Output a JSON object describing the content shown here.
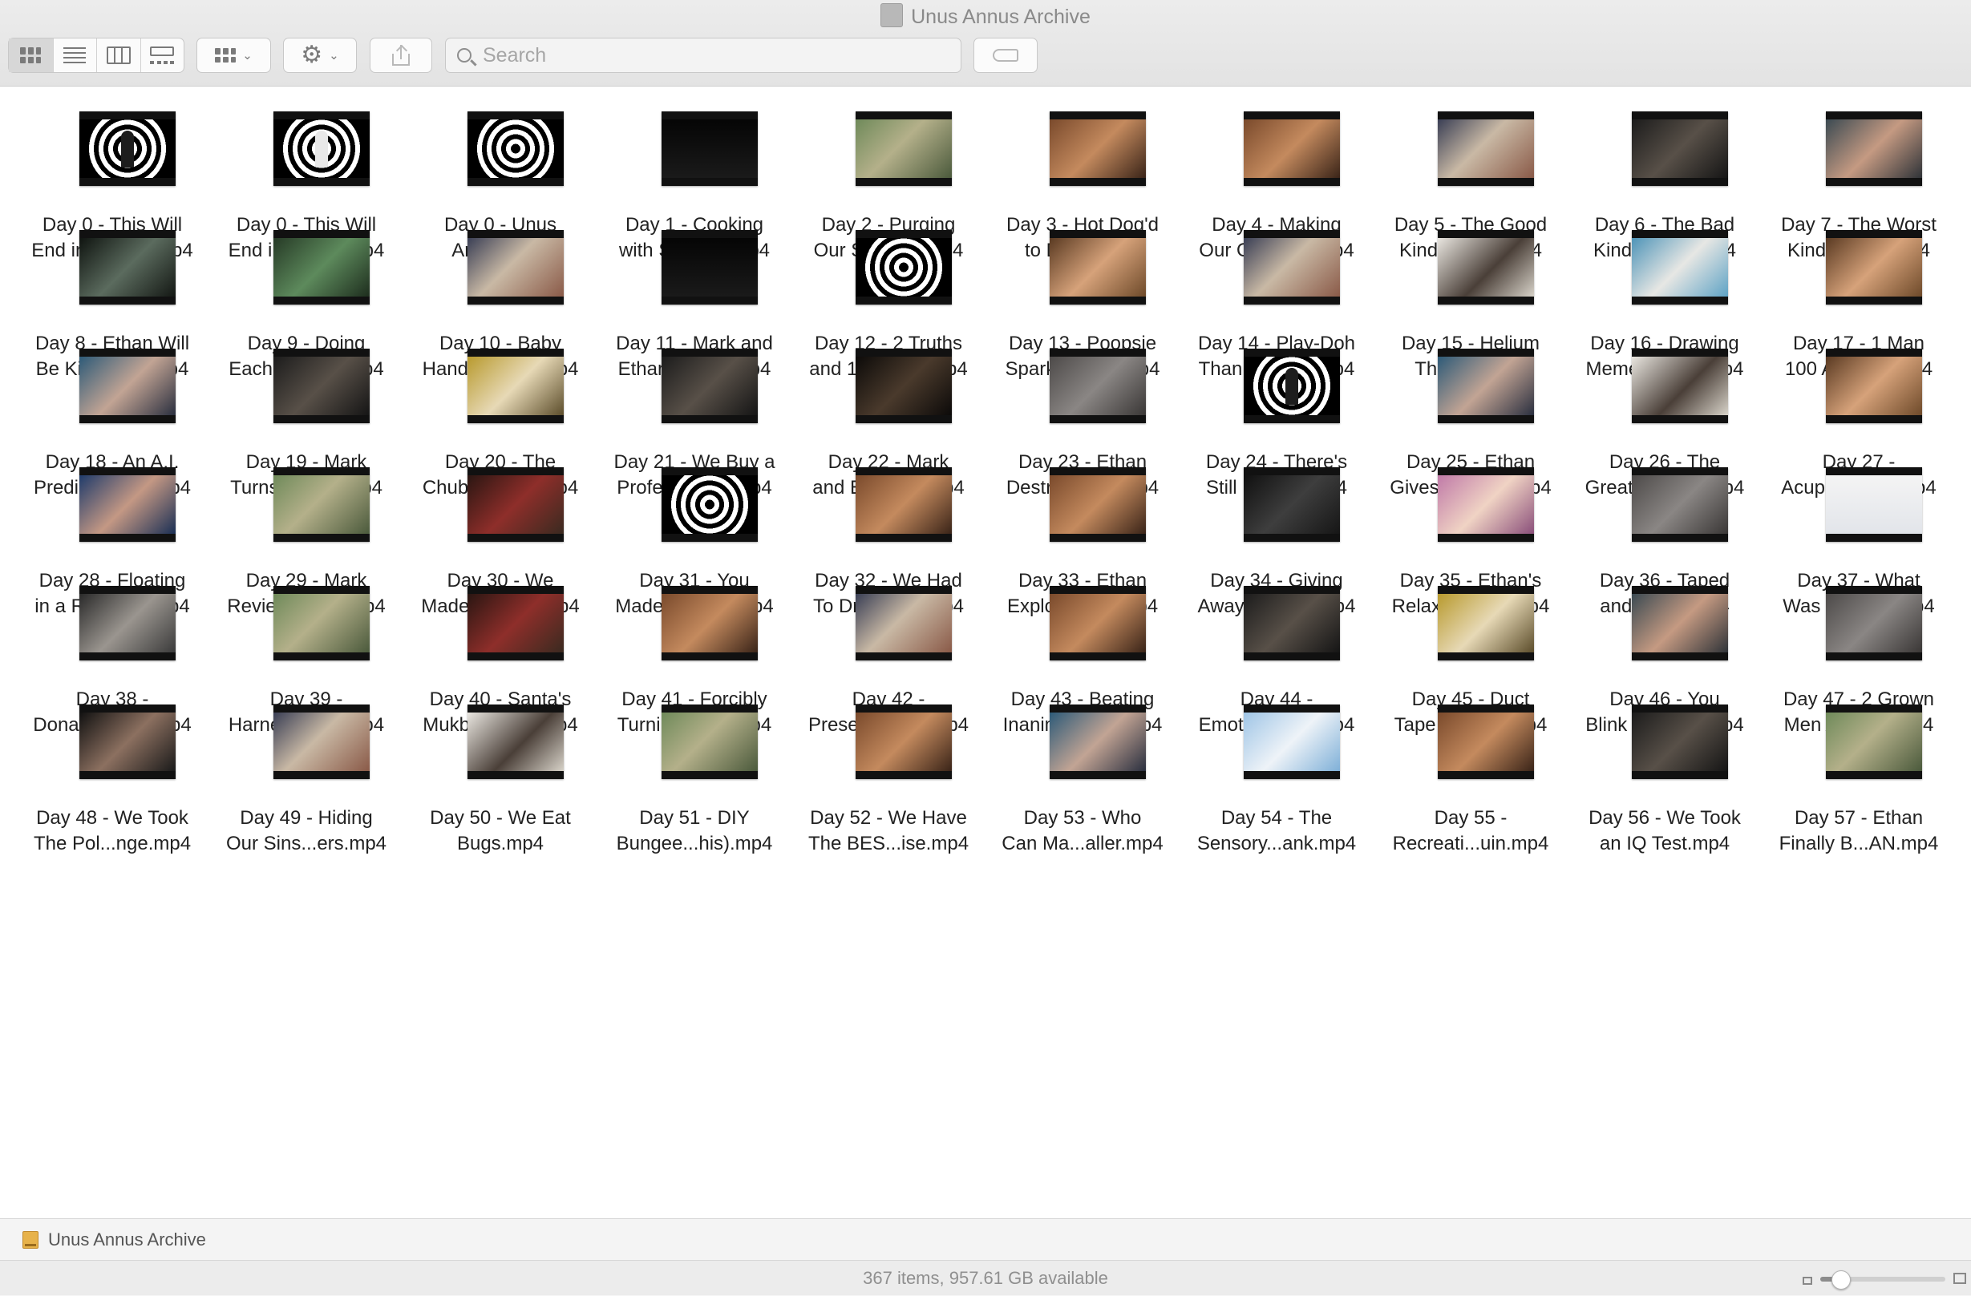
{
  "window": {
    "title": "Unus Annus Archive"
  },
  "toolbar": {
    "view_modes": [
      "icon-view",
      "list-view",
      "column-view",
      "gallery-view"
    ],
    "active_view": "icon-view",
    "group_icon": "group-by-icon",
    "action_icon": "gear-icon",
    "share_icon": "share-icon",
    "tag_icon": "tag-icon"
  },
  "search": {
    "placeholder": "Search",
    "value": ""
  },
  "files": [
    {
      "line1": "Day 0 - This Will",
      "line2": "End in O...an).mp4",
      "thumb": "spiral-person"
    },
    {
      "line1": "Day 0 - This Will",
      "line2": "End in O...rk).mp4",
      "thumb": "spiral-person-light"
    },
    {
      "line1": "Day 0 - Unus",
      "line2": "Annus.mp4",
      "thumb": "spiral"
    },
    {
      "line1": "Day 1 - Cooking",
      "line2": "with Sex...ys.mp4",
      "thumb": "text-card"
    },
    {
      "line1": "Day 2 - Purging",
      "line2": "Our Sins...ot.mp4",
      "thumb": "outdoor"
    },
    {
      "line1": "Day 3 - Hot Dog'd",
      "line2": "to Death.mp4",
      "thumb": "warm"
    },
    {
      "line1": "Day 4 - Making",
      "line2": "Our Ow...ank.mp4",
      "thumb": "warm"
    },
    {
      "line1": "Day 5 - The Good",
      "line2": "Kind of...🙂.mp4",
      "thumb": "studio"
    },
    {
      "line1": "Day 6 - The Bad",
      "line2": "Kind of...😐.mp4",
      "thumb": "dark-two"
    },
    {
      "line1": "Day 7 - The Worst",
      "line2": "Kind of...😨.mp4",
      "thumb": "face"
    },
    {
      "line1": "Day 8 - Ethan Will",
      "line2": "Be Kick...alls.mp4",
      "thumb": "night"
    },
    {
      "line1": "Day 9 - Doing",
      "line2": "Each Ot...ark.mp4",
      "thumb": "green"
    },
    {
      "line1": "Day 10 - Baby",
      "line2": "Hands...ation.mp4",
      "thumb": "studio"
    },
    {
      "line1": "Day 11 - Mark and",
      "line2": "Ethan S...ost.mp4",
      "thumb": "text-card"
    },
    {
      "line1": "Day 12 - 2 Truths",
      "line2": "and 1 Li...tion.mp4",
      "thumb": "spiral"
    },
    {
      "line1": "Day 13 - Poopsie",
      "line2": "Sparkly...e...).mp4",
      "thumb": "face-warm"
    },
    {
      "line1": "Day 14 - Play-Doh",
      "line2": "Thanksgiving.mp4",
      "thumb": "studio"
    },
    {
      "line1": "Day 15 - Helium",
      "line2": "Therapy.mp4",
      "thumb": "bright"
    },
    {
      "line1": "Day 16 - Drawing",
      "line2": "Memes f...ory.mp4",
      "thumb": "pool"
    },
    {
      "line1": "Day 17 - 1 Man",
      "line2": "100 Accents.mp4",
      "thumb": "face-warm"
    },
    {
      "line1": "Day 18 - An A.I.",
      "line2": "Predicts...Die.mp4",
      "thumb": "blue-room"
    },
    {
      "line1": "Day 19 - Mark",
      "line2": "Turns Et...nd.mp4",
      "thumb": "dark-two"
    },
    {
      "line1": "Day 20 - The",
      "line2": "Chubby...nge.mp4",
      "thumb": "yellow"
    },
    {
      "line1": "Day 21 - We Buy a",
      "line2": "Professi...o It.mp4",
      "thumb": "dark-two"
    },
    {
      "line1": "Day 22 - Mark",
      "line2": "and Eth...om.mp4",
      "thumb": "dark-text"
    },
    {
      "line1": "Day 23 - Ethan",
      "line2": "Destroy...Bat.mp4",
      "thumb": "grey-room"
    },
    {
      "line1": "Day 24 - There's",
      "line2": "Still Hope....mp4",
      "thumb": "spiral-person"
    },
    {
      "line1": "Day 25 - Ethan",
      "line2": "Gives M...eral.mp4",
      "thumb": "blue-room"
    },
    {
      "line1": "Day 26 - The",
      "line2": "Great M...ake.mp4",
      "thumb": "bright"
    },
    {
      "line1": "Day 27 -",
      "line2": "Acupun...nful.mp4",
      "thumb": "face-warm"
    },
    {
      "line1": "Day 28 - Floating",
      "line2": "in a Real...nk.mp4",
      "thumb": "blue-face"
    },
    {
      "line1": "Day 29 - Mark",
      "line2": "Reviews...om.mp4",
      "thumb": "outdoor"
    },
    {
      "line1": "Day 30 - We",
      "line2": "Made N...ther.mp4",
      "thumb": "red-dark"
    },
    {
      "line1": "Day 31 - You",
      "line2": "Made B...Win.mp4",
      "thumb": "spiral"
    },
    {
      "line1": "Day 32 - We Had",
      "line2": "To Drink...ee.mp4",
      "thumb": "warm"
    },
    {
      "line1": "Day 33 - Ethan",
      "line2": "Explore...ent.mp4",
      "thumb": "warm"
    },
    {
      "line1": "Day 34 - Giving",
      "line2": "Away O...tton.mp4",
      "thumb": "dark-hood"
    },
    {
      "line1": "Day 35 - Ethan's",
      "line2": "Relaxing...🎻.mp4",
      "thumb": "pink"
    },
    {
      "line1": "Day 36 - Taped",
      "line2": "and Afraid.mp4",
      "thumb": "grey-room"
    },
    {
      "line1": "Day 37 - What",
      "line2": "Was Th...red.mp4",
      "thumb": "white-chart"
    },
    {
      "line1": "Day 38 -",
      "line2": "Donatin...Eye.mp4",
      "thumb": "car"
    },
    {
      "line1": "Day 39 -",
      "line2": "Harness...rgy.mp4",
      "thumb": "outdoor"
    },
    {
      "line1": "Day 40 - Santa's",
      "line2": "Mukban...og).mp4",
      "thumb": "red-dark"
    },
    {
      "line1": "Day 41 - Forcibly",
      "line2": "Turning...Will.mp4",
      "thumb": "warm"
    },
    {
      "line1": "Day 42 -",
      "line2": "Preservin...ax.mp4",
      "thumb": "studio"
    },
    {
      "line1": "Day 43 - Beating",
      "line2": "Inanimat...ath.mp4",
      "thumb": "warm"
    },
    {
      "line1": "Day 44 -",
      "line2": "Emotion...rse.mp4",
      "thumb": "dark-two"
    },
    {
      "line1": "Day 45 - Duct",
      "line2": "Tape Cr...eo).mp4",
      "thumb": "yellow"
    },
    {
      "line1": "Day 46 - You",
      "line2": "Blink Yo...ose.mp4",
      "thumb": "face"
    },
    {
      "line1": "Day 47 - 2 Grown",
      "line2": "Men Att...est.mp4",
      "thumb": "grey-room"
    },
    {
      "line1": "Day 48 - We Took",
      "line2": "The Pol...nge.mp4",
      "thumb": "dark-face"
    },
    {
      "line1": "Day 49 - Hiding",
      "line2": "Our Sins...ers.mp4",
      "thumb": "studio"
    },
    {
      "line1": "Day 50 - We Eat",
      "line2": "Bugs.mp4",
      "thumb": "bright"
    },
    {
      "line1": "Day 51 - DIY",
      "line2": "Bungee...his).mp4",
      "thumb": "outdoor"
    },
    {
      "line1": "Day 52 - We Have",
      "line2": "The BES...ise.mp4",
      "thumb": "warm"
    },
    {
      "line1": "Day 53 - Who",
      "line2": "Can Ma...aller.mp4",
      "thumb": "blue-room"
    },
    {
      "line1": "Day 54 - The",
      "line2": "Sensory...ank.mp4",
      "thumb": "light-blue"
    },
    {
      "line1": "Day 55 -",
      "line2": "Recreati...uin.mp4",
      "thumb": "warm"
    },
    {
      "line1": "Day 56 - We Took",
      "line2": "an IQ Test.mp4",
      "thumb": "dark-two"
    },
    {
      "line1": "Day 57 - Ethan",
      "line2": "Finally B...AN.mp4",
      "thumb": "outdoor"
    }
  ],
  "thumb_palettes": {
    "spiral": "spiral",
    "spiral-person": "spiral",
    "spiral-person-light": "spiral",
    "text-card": "linear-gradient(#050505,#1a1a1a)",
    "outdoor": "linear-gradient(135deg,#6f8a5a,#b4b08a 45%,#4b5a3c)",
    "warm": "linear-gradient(135deg,#7a4a2c,#c48a5e 50%,#3a2418)",
    "studio": "linear-gradient(135deg,#3a3f55,#c9b9a5 45%,#8a5a48)",
    "dark-two": "linear-gradient(135deg,#1c1c1c,#585048 50%,#151515)",
    "face": "linear-gradient(135deg,#3b4a52,#c59a82 50%,#2f3338)",
    "night": "linear-gradient(135deg,#0f1410,#5b6b5e 50%,#141814)",
    "green": "linear-gradient(135deg,#263a26,#5d8a5c 50%,#1e2e1e)",
    "face-warm": "linear-gradient(135deg,#5a3a22,#d6a27a 50%,#6e4a2a)",
    "bright": "linear-gradient(135deg,#e9e6e0,#4a3f38 55%,#d7d2c8)",
    "pool": "linear-gradient(135deg,#4e94b8,#e7e7e4 50%,#5fa3c5)",
    "blue-room": "linear-gradient(135deg,#2d5a78,#c2a494 50%,#2a2f3f)",
    "yellow": "linear-gradient(135deg,#b89a2e,#e7d9b6 50%,#5c4d2b)",
    "dark-text": "linear-gradient(135deg,#0c0a09,#4a3a2c 50%,#0c0a09)",
    "grey-room": "linear-gradient(135deg,#4d4a49,#8a8684 50%,#3a3736)",
    "blue-face": "linear-gradient(135deg,#1f3b6b,#c49884 50%,#1a2f55)",
    "red-dark": "linear-gradient(135deg,#2a1612,#8e2e2a 50%,#3a2a20)",
    "dark-hood": "linear-gradient(135deg,#101010,#3e3e3e 50%,#161616)",
    "pink": "linear-gradient(135deg,#c07aa8,#f0d3c4 50%,#8a4f7a)",
    "white-chart": "linear-gradient(#f4f4f4,#e2e5ea)",
    "car": "linear-gradient(135deg,#2a2a2a,#9a958f 50%,#3b3b3b)",
    "dark-face": "linear-gradient(135deg,#111111,#8c7060 50%,#1a1a1a)",
    "light-blue": "linear-gradient(135deg,#9fc5e6,#eef3f8 50%,#7fb0d8)"
  },
  "pathbar": {
    "folder_icon": "drive-folder-icon",
    "label": "Unus Annus Archive"
  },
  "statusbar": {
    "text": "367 items, 957.61 GB available",
    "zoom_level": 0.16
  }
}
